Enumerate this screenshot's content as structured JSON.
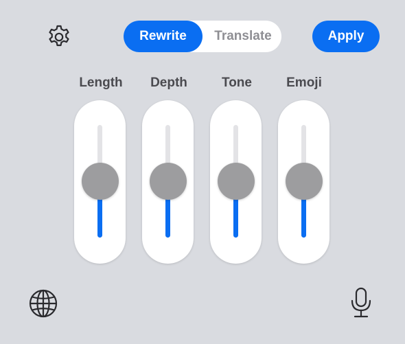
{
  "toolbar": {
    "settings_icon": "gear-icon",
    "mode_options": [
      "Rewrite",
      "Translate"
    ],
    "selected_mode": "Rewrite",
    "apply_label": "Apply"
  },
  "sliders": [
    {
      "label": "Length",
      "value": 0.5
    },
    {
      "label": "Depth",
      "value": 0.5
    },
    {
      "label": "Tone",
      "value": 0.5
    },
    {
      "label": "Emoji",
      "value": 0.5
    }
  ],
  "bottom_bar": {
    "left_icon": "globe-icon",
    "right_icon": "microphone-icon"
  },
  "colors": {
    "accent": "#0a6ef2",
    "background": "#d9dbe0",
    "thumb": "#9d9d9f",
    "track": "#e3e3e6"
  }
}
